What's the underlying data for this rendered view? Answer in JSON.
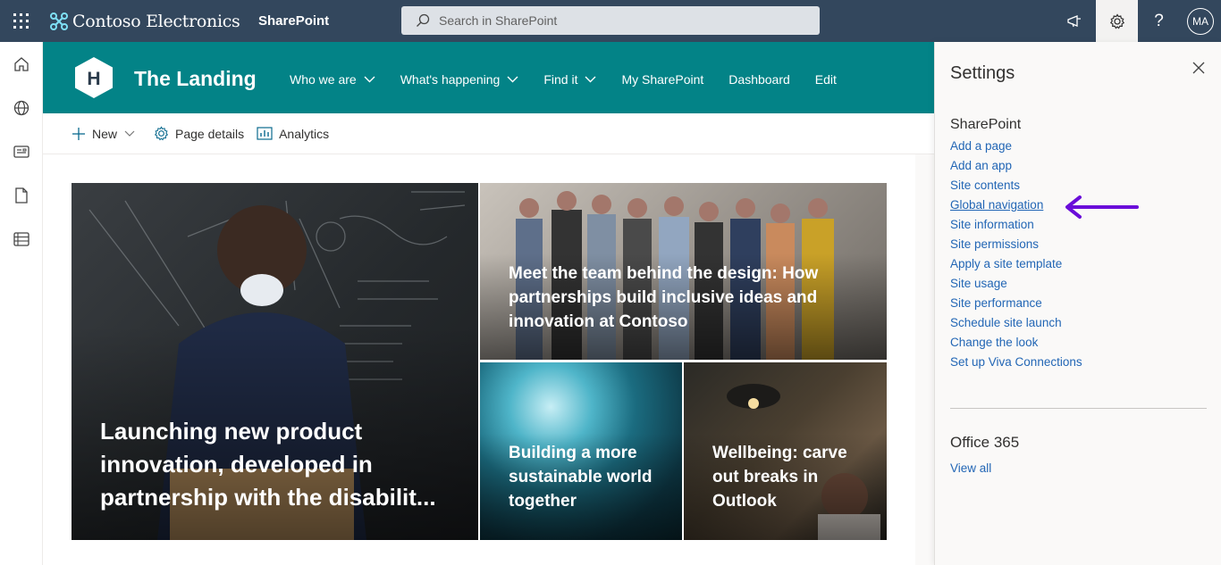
{
  "suitebar": {
    "brand": "Contoso Electronics",
    "app": "SharePoint",
    "search_placeholder": "Search in SharePoint",
    "avatar_initials": "MA",
    "icons": [
      "app-launcher-icon",
      "megaphone-icon",
      "gear-icon",
      "help-icon"
    ]
  },
  "rail": {
    "icons": [
      "home-icon",
      "globe-icon",
      "news-icon",
      "document-icon",
      "lists-icon"
    ]
  },
  "site": {
    "logo_letter": "H",
    "title": "The Landing",
    "nav": [
      {
        "label": "Who we are",
        "dropdown": true
      },
      {
        "label": "What's happening",
        "dropdown": true
      },
      {
        "label": "Find it",
        "dropdown": true
      },
      {
        "label": "My SharePoint",
        "dropdown": false
      },
      {
        "label": "Dashboard",
        "dropdown": false
      },
      {
        "label": "Edit",
        "dropdown": false
      }
    ],
    "theme_color": "#038387"
  },
  "commandbar": {
    "new": "New",
    "page_details": "Page details",
    "analytics": "Analytics"
  },
  "hero": {
    "tiles": [
      {
        "title": "Launching new product innovation, developed in partnership with the disabilit..."
      },
      {
        "title": "Meet the team behind the design: How partnerships build inclusive ideas and innovation at Contoso"
      },
      {
        "title": "Building a more sustainable world together"
      },
      {
        "title": "Wellbeing: carve out breaks in Outlook"
      }
    ]
  },
  "settings": {
    "title": "Settings",
    "sharepoint_heading": "SharePoint",
    "links": [
      "Add a page",
      "Add an app",
      "Site contents",
      "Global navigation",
      "Site information",
      "Site permissions",
      "Apply a site template",
      "Site usage",
      "Site performance",
      "Schedule site launch",
      "Change the look",
      "Set up Viva Connections"
    ],
    "highlighted_link": "Global navigation",
    "office_heading": "Office 365",
    "view_all": "View all",
    "link_color": "#2266b5",
    "arrow_color": "#6a0dd9"
  }
}
